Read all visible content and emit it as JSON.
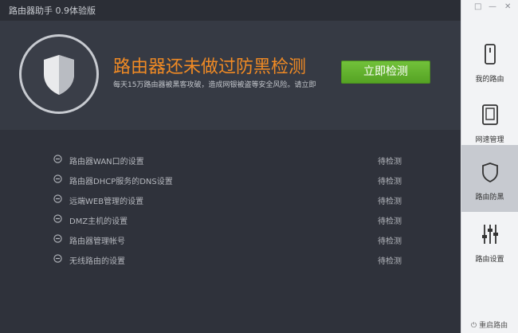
{
  "window": {
    "title": "路由器助手 0.9体验版"
  },
  "hero": {
    "title": "路由器还未做过防黑检测",
    "subtitle": "每天15万路由器被黑客攻破，造成网银被盗等安全风险。请立即",
    "button_label": "立即检测"
  },
  "checks": [
    {
      "label": "路由器WAN口的设置",
      "status": "待检测"
    },
    {
      "label": "路由器DHCP服务的DNS设置",
      "status": "待检测"
    },
    {
      "label": "远端WEB管理的设置",
      "status": "待检测"
    },
    {
      "label": "DMZ主机的设置",
      "status": "待检测"
    },
    {
      "label": "路由器管理帐号",
      "status": "待检测"
    },
    {
      "label": "无线路由的设置",
      "status": "待检测"
    }
  ],
  "sidebar": {
    "items": [
      {
        "label": "我的路由",
        "icon": "router-icon"
      },
      {
        "label": "网速管理",
        "icon": "tablet-icon"
      },
      {
        "label": "路由防黑",
        "icon": "shield-icon"
      },
      {
        "label": "路由设置",
        "icon": "sliders-icon"
      }
    ],
    "active_index": 2,
    "reset_label": "重启路由"
  },
  "colors": {
    "accent_orange": "#f08a24",
    "button_green": "#5cb12a",
    "main_bg": "#2f323b",
    "sidebar_bg": "#f2f3f5",
    "sidebar_active": "#c7cad0"
  }
}
